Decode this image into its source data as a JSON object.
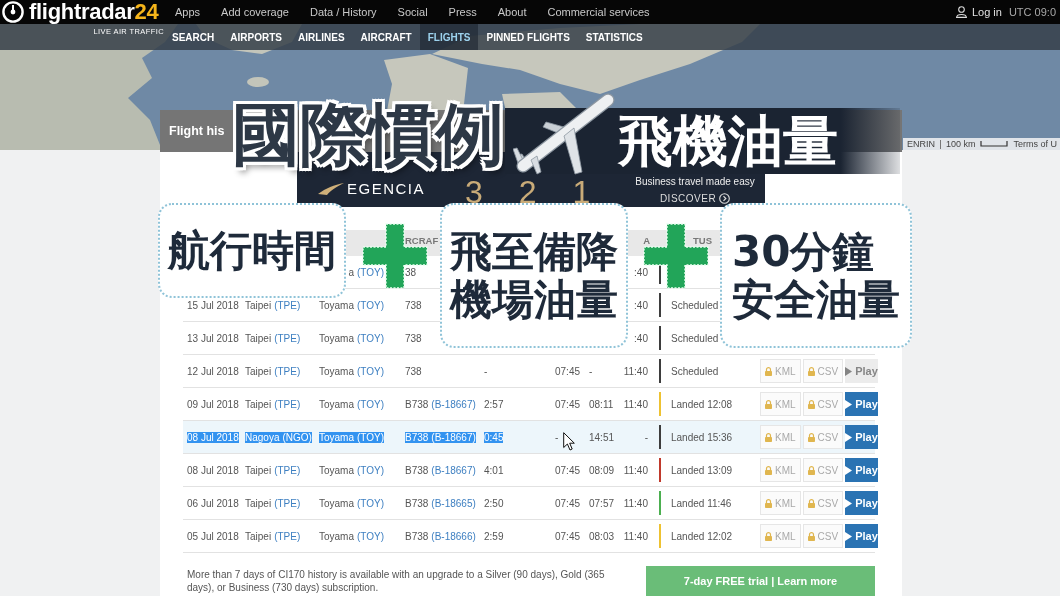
{
  "top_bar": {
    "logo": {
      "name": "flightradar",
      "suffix": "24",
      "tagline": "LIVE AIR TRAFFIC"
    },
    "menu": [
      "Apps",
      "Add coverage",
      "Data / History",
      "Social",
      "Press",
      "About",
      "Commercial services"
    ],
    "login": "Log in",
    "clock": "UTC 09:0"
  },
  "nav_tabs": [
    {
      "label": "SEARCH",
      "selected": false
    },
    {
      "label": "AIRPORTS",
      "selected": false
    },
    {
      "label": "AIRLINES",
      "selected": false
    },
    {
      "label": "AIRCRAFT",
      "selected": false
    },
    {
      "label": "FLIGHTS",
      "selected": true
    },
    {
      "label": "PINNED FLIGHTS",
      "selected": false
    },
    {
      "label": "STATISTICS",
      "selected": false
    }
  ],
  "map": {
    "attribution": "ENRIN",
    "scale": "100 km",
    "terms": "Terms of U"
  },
  "panel": {
    "title": "Flight his"
  },
  "ad": {
    "brand": "EGENCIA",
    "countdown": [
      "3",
      "2",
      "1"
    ],
    "tagline": "Business travel made easy",
    "cta": "DISCOVER"
  },
  "table": {
    "header": {
      "column_4": "RCRAF",
      "column_8": "A",
      "column_9": "TUS"
    },
    "rows": [
      {
        "column_3": {
          "text": "a",
          "link": "(TOY)"
        },
        "column_4": {
          "text": "38"
        },
        "column_8": ":40",
        "color": "#3d3d3d",
        "selected": false
      },
      {
        "column_1": "15 Jul 2018",
        "column_2": {
          "text": "Taipei",
          "link": "(TPE)"
        },
        "column_3": {
          "text": "Toyama",
          "link": "(TOY)"
        },
        "column_4": {
          "text": "738"
        },
        "column_8": ":40",
        "column_9": "Scheduled",
        "color": "#3d3d3d",
        "selected": false
      },
      {
        "column_1": "13 Jul 2018",
        "column_2": {
          "text": "Taipei",
          "link": "(TPE)"
        },
        "column_3": {
          "text": "Toyama",
          "link": "(TOY)"
        },
        "column_4": {
          "text": "738"
        },
        "column_8": ":40",
        "column_9": "Scheduled",
        "color": "#3d3d3d",
        "selected": false
      },
      {
        "column_1": "12 Jul 2018",
        "column_2": {
          "text": "Taipei",
          "link": "(TPE)"
        },
        "column_3": {
          "text": "Toyama",
          "link": "(TOY)"
        },
        "column_4": {
          "text": "738"
        },
        "column_5": "-",
        "column_6": "07:45",
        "column_7": "-",
        "column_8": "11:40",
        "column_9": "Scheduled",
        "color": "#3d3d3d",
        "selected": false,
        "actions": [
          {
            "kind": "locked",
            "label": "KML"
          },
          {
            "kind": "locked",
            "label": "CSV"
          },
          {
            "kind": "play",
            "label": "Play",
            "disabled": true
          }
        ]
      },
      {
        "column_1": "09 Jul 2018",
        "column_2": {
          "text": "Taipei",
          "link": "(TPE)"
        },
        "column_3": {
          "text": "Toyama",
          "link": "(TOY)"
        },
        "column_4": {
          "text": "B738",
          "link": "(B-18667)"
        },
        "column_5": "2:57",
        "column_6": "07:45",
        "column_7": "08:11",
        "column_8": "11:40",
        "column_9": "Landed 12:08",
        "color": "#eec231",
        "selected": false,
        "actions": [
          {
            "kind": "locked",
            "label": "KML"
          },
          {
            "kind": "locked",
            "label": "CSV"
          },
          {
            "kind": "play",
            "label": "Play",
            "disabled": false
          }
        ]
      },
      {
        "column_1": "08 Jul 2018",
        "column_2": {
          "text": "Nagoya",
          "link": "(NGO)"
        },
        "column_3": {
          "text": "Toyama",
          "link": "(TOY)"
        },
        "column_4": {
          "text": "B738",
          "link": "(B-18667)"
        },
        "column_5": "0:45",
        "column_6": "-",
        "column_7": "14:51",
        "column_8": "-",
        "column_9": "Landed 15:36",
        "color": "#3d3d3d",
        "selected": true,
        "actions": [
          {
            "kind": "locked",
            "label": "KML"
          },
          {
            "kind": "locked",
            "label": "CSV"
          },
          {
            "kind": "play",
            "label": "Play",
            "disabled": false
          }
        ]
      },
      {
        "column_1": "08 Jul 2018",
        "column_2": {
          "text": "Taipei",
          "link": "(TPE)"
        },
        "column_3": {
          "text": "Toyama",
          "link": "(TOY)"
        },
        "column_4": {
          "text": "B738",
          "link": "(B-18667)"
        },
        "column_5": "4:01",
        "column_6": "07:45",
        "column_7": "08:09",
        "column_8": "11:40",
        "column_9": "Landed 13:09",
        "color": "#c0392b",
        "selected": false,
        "actions": [
          {
            "kind": "locked",
            "label": "KML"
          },
          {
            "kind": "locked",
            "label": "CSV"
          },
          {
            "kind": "play",
            "label": "Play",
            "disabled": false
          }
        ]
      },
      {
        "column_1": "06 Jul 2018",
        "column_2": {
          "text": "Taipei",
          "link": "(TPE)"
        },
        "column_3": {
          "text": "Toyama",
          "link": "(TOY)"
        },
        "column_4": {
          "text": "B738",
          "link": "(B-18665)"
        },
        "column_5": "2:50",
        "column_6": "07:45",
        "column_7": "07:57",
        "column_8": "11:40",
        "column_9": "Landed 11:46",
        "color": "#4caf50",
        "selected": false,
        "actions": [
          {
            "kind": "locked",
            "label": "KML"
          },
          {
            "kind": "locked",
            "label": "CSV"
          },
          {
            "kind": "play",
            "label": "Play",
            "disabled": false
          }
        ]
      },
      {
        "column_1": "05 Jul 2018",
        "column_2": {
          "text": "Taipei",
          "link": "(TPE)"
        },
        "column_3": {
          "text": "Toyama",
          "link": "(TOY)"
        },
        "column_4": {
          "text": "B738",
          "link": "(B-18666)"
        },
        "column_5": "2:59",
        "column_6": "07:45",
        "column_7": "08:03",
        "column_8": "11:40",
        "column_9": "Landed 12:02",
        "color": "#eec231",
        "selected": false,
        "actions": [
          {
            "kind": "locked",
            "label": "KML"
          },
          {
            "kind": "locked",
            "label": "CSV"
          },
          {
            "kind": "play",
            "label": "Play",
            "disabled": false
          }
        ]
      }
    ]
  },
  "footer": {
    "note": "More than 7 days of CI170 history is available with an upgrade to a Silver (90 days), Gold (365 days), or Business (730 days) subscription.",
    "trial_button": "7-day FREE trial | Learn more"
  },
  "overlay": {
    "headline": "國際慣例",
    "topic": "飛機油量",
    "captions": [
      {
        "lines": [
          "航行時間"
        ]
      },
      {
        "lines": [
          "飛至備降",
          "機場油量"
        ]
      },
      {
        "lines": [
          "30分鐘",
          "安全油量"
        ]
      }
    ]
  }
}
